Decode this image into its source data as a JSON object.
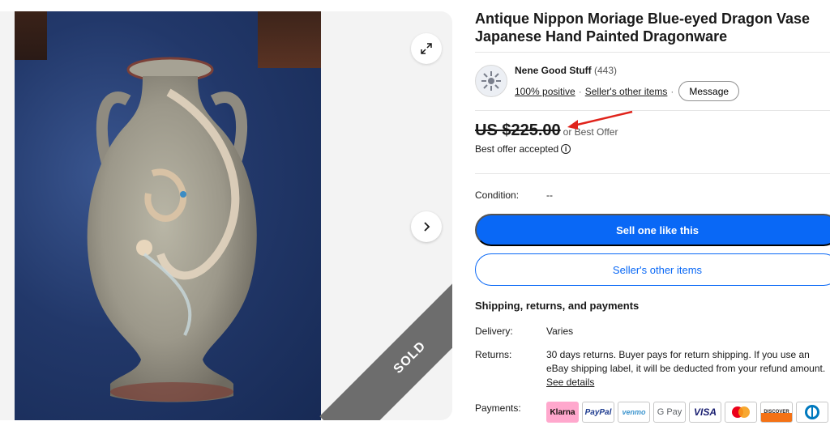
{
  "gallery": {
    "sold_label": "SOLD",
    "expand_icon": "expand-icon",
    "next_icon": "chevron-right-icon"
  },
  "item": {
    "title": "Antique Nippon Moriage Blue-eyed Dragon Vase Japanese Hand Painted Dragonware"
  },
  "seller": {
    "name": "Nene Good Stuff",
    "feedback_count": "(443)",
    "positive": "100% positive",
    "other_items": "Seller's other items",
    "message_label": "Message"
  },
  "price": {
    "amount": "US $225.00",
    "best_offer": "or Best Offer",
    "offer_status": "Best offer accepted"
  },
  "condition": {
    "label": "Condition:",
    "value": "--"
  },
  "actions": {
    "sell_label": "Sell one like this",
    "other_items_label": "Seller's other items"
  },
  "shipping": {
    "heading": "Shipping, returns, and payments",
    "delivery_label": "Delivery:",
    "delivery_value": "Varies",
    "returns_label": "Returns:",
    "returns_value": "30 days returns. Buyer pays for return shipping. If you use an eBay shipping label, it will be deducted from your refund amount.",
    "see_details": "See details",
    "payments_label": "Payments:"
  },
  "payments": [
    "Klarna",
    "PayPal",
    "venmo",
    "G Pay",
    "VISA",
    "Mastercard",
    "DISCOVER",
    "Diners Club"
  ],
  "colors": {
    "accent": "#0968f6",
    "sold_ribbon": "#6d6d6d",
    "arrow": "#e0231b"
  }
}
